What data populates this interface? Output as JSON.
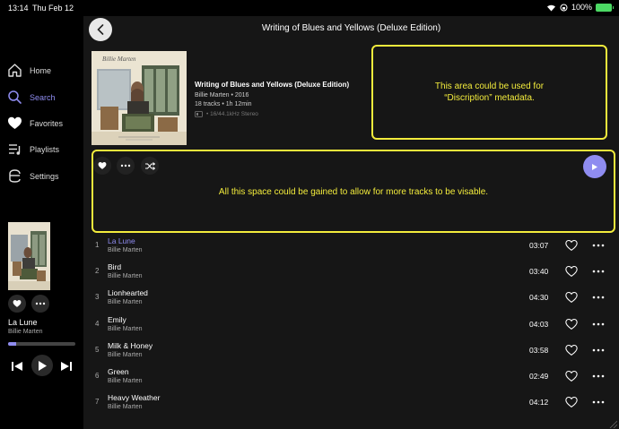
{
  "status": {
    "time": "13:14",
    "date": "Thu Feb 12",
    "battery": "100%"
  },
  "sidebar": {
    "items": [
      {
        "label": "Home",
        "icon": "home-icon",
        "active": false
      },
      {
        "label": "Search",
        "icon": "search-icon",
        "active": true
      },
      {
        "label": "Favorites",
        "icon": "heart-icon",
        "active": false
      },
      {
        "label": "Playlists",
        "icon": "playlist-icon",
        "active": false
      },
      {
        "label": "Settings",
        "icon": "settings-icon",
        "active": false
      }
    ]
  },
  "now_playing": {
    "title": "La Lune",
    "artist": "Billie Marten",
    "progress": 0.12
  },
  "album": {
    "page_title": "Writing of Blues and Yellows (Deluxe Edition)",
    "name": "Writing of Blues and Yellows (Deluxe Edition)",
    "artist_year": "Billie Marten • 2016",
    "tracks_duration": "18 tracks • 1h 12min",
    "format": "• 16/44.1kHz Stereo",
    "cover_text": "Billie Marten"
  },
  "annotations": {
    "description": "This area could be used for “Discription” metadata.",
    "space": "All this space could be gained to allow for more tracks to be visable."
  },
  "tracks": [
    {
      "num": "1",
      "title": "La Lune",
      "artist": "Billie Marten",
      "duration": "03:07",
      "playing": true
    },
    {
      "num": "2",
      "title": "Bird",
      "artist": "Billie Marten",
      "duration": "03:40",
      "playing": false
    },
    {
      "num": "3",
      "title": "Lionhearted",
      "artist": "Billie Marten",
      "duration": "04:30",
      "playing": false
    },
    {
      "num": "4",
      "title": "Emily",
      "artist": "Billie Marten",
      "duration": "04:03",
      "playing": false
    },
    {
      "num": "5",
      "title": "Milk & Honey",
      "artist": "Billie Marten",
      "duration": "03:58",
      "playing": false
    },
    {
      "num": "6",
      "title": "Green",
      "artist": "Billie Marten",
      "duration": "02:49",
      "playing": false
    },
    {
      "num": "7",
      "title": "Heavy Weather",
      "artist": "Billie Marten",
      "duration": "04:12",
      "playing": false
    }
  ],
  "colors": {
    "accent": "#8f8cf0",
    "annotation": "#f3ec3c",
    "background": "#161616"
  }
}
